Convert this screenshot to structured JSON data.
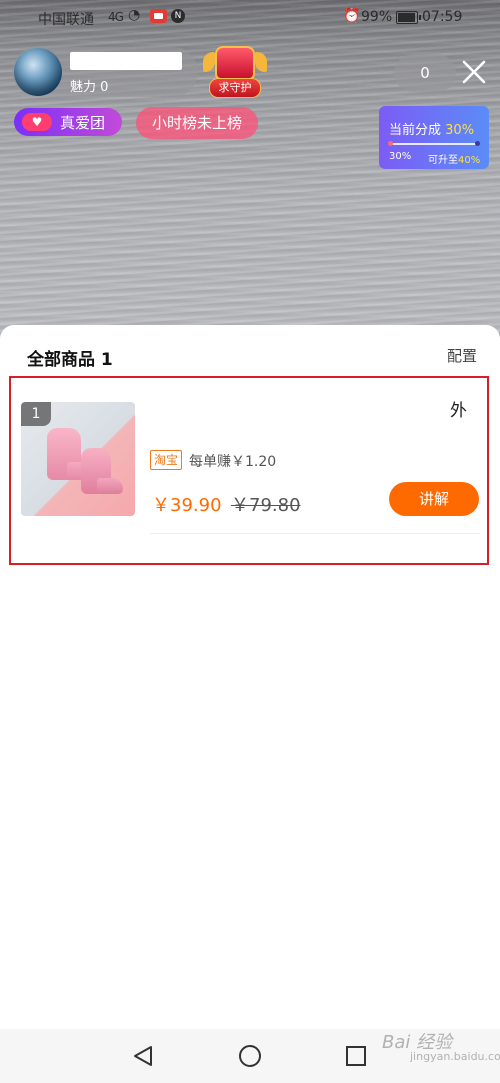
{
  "status_bar": {
    "carrier": "中国联通",
    "signal_glyph": "4G",
    "battery_percent": "99%",
    "time": "07:59"
  },
  "live": {
    "charm_label": "魅力 0",
    "guard_label": "求守护",
    "viewer_count": "0",
    "fan_group_label": "真爱团",
    "rank_label": "小时榜未上榜",
    "share_card": {
      "title": "当前分成",
      "current_percent": "30%",
      "from_percent": "30%",
      "upgrade_label": "可升至",
      "upgrade_percent": "40%"
    }
  },
  "product_sheet": {
    "title": "全部商品 1",
    "config_label": "配置",
    "items": [
      {
        "rank": "1",
        "title_visible": "外",
        "source_tag": "淘宝",
        "commission": "每单赚￥1.20",
        "price": "￥39.90",
        "original_price": "￥79.80",
        "action_label": "讲解"
      }
    ]
  },
  "watermark": {
    "text": "Bai 经验",
    "sub": "jingyan.baidu.com"
  },
  "colors": {
    "accent_orange": "#ff6a00",
    "highlight_red": "#d81e2a",
    "fan_purple": "#7b2ff7",
    "share_blue": "#5b8cf7"
  }
}
